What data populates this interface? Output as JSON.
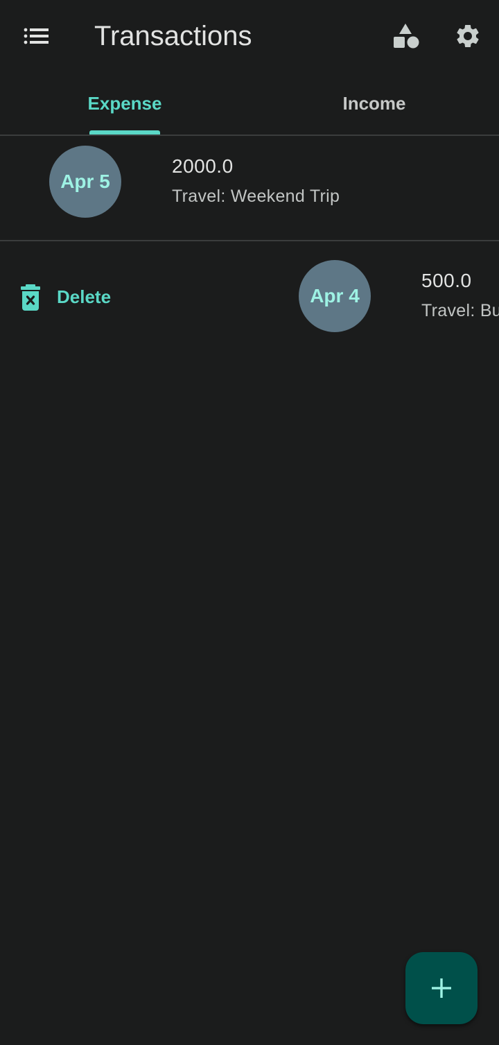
{
  "header": {
    "title": "Transactions",
    "menu_icon": "list-icon",
    "categories_icon": "shapes-icon",
    "settings_icon": "gear-icon"
  },
  "tabs": [
    {
      "label": "Expense",
      "selected": true
    },
    {
      "label": "Income",
      "selected": false
    }
  ],
  "transactions": [
    {
      "date": "Apr 5",
      "amount": "2000.0",
      "description": "Travel: Weekend Trip"
    },
    {
      "date": "Apr 4",
      "amount": "500.0",
      "description": "Travel: Bu"
    }
  ],
  "swipe_action": {
    "label": "Delete",
    "icon": "delete-icon"
  },
  "fab": {
    "icon": "plus-icon"
  },
  "colors": {
    "background": "#1b1c1c",
    "accent": "#5ad8c6",
    "date_circle": "#5e7786",
    "fab": "#00504a"
  }
}
